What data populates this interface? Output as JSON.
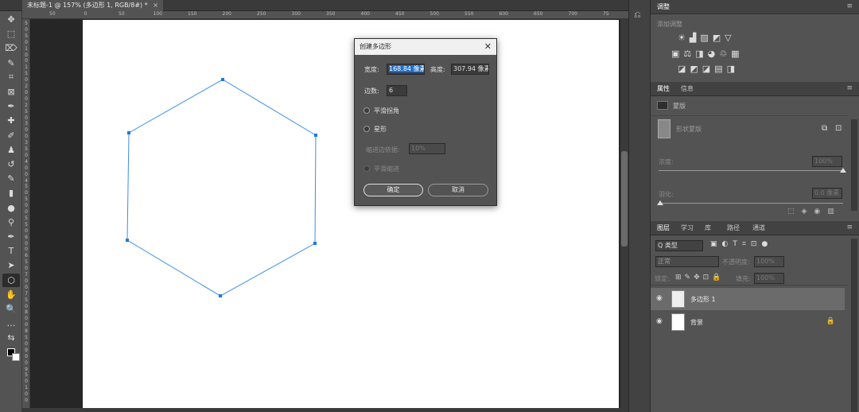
{
  "document_tab": {
    "title": "未标题-1 @ 157% (多边形 1, RGB/8#) *",
    "close": "×"
  },
  "ruler": {
    "h_ticks": [
      "50",
      "0",
      "50",
      "100",
      "150",
      "200",
      "250",
      "300",
      "350",
      "400",
      "450",
      "500",
      "550",
      "600",
      "650",
      "700",
      "75"
    ],
    "v_ticks": [
      "5",
      "0",
      "5",
      "0",
      "1",
      "0",
      "0",
      "1",
      "5",
      "0",
      "2",
      "0",
      "0",
      "2",
      "5",
      "0",
      "3",
      "0",
      "0",
      "3",
      "5",
      "0",
      "4",
      "0",
      "0",
      "4",
      "5",
      "0",
      "5",
      "0",
      "0",
      "5",
      "5",
      "0",
      "6",
      "0",
      "0",
      "6",
      "5",
      "0",
      "7",
      "0",
      "0",
      "7",
      "5",
      "0",
      "8",
      "0",
      "0",
      "8",
      "5",
      "0",
      "9",
      "0",
      "0",
      "9",
      "5",
      "0",
      "1",
      "0",
      "0"
    ]
  },
  "tools": [
    "✥",
    "⬚",
    "⌦",
    "✎",
    "⌗",
    "⊠",
    "✒",
    "✚",
    "✐",
    "♟",
    "↺",
    "✎",
    "▮",
    "●",
    "⚲",
    "✒",
    "T",
    "➤",
    "⬡",
    "✋",
    "🔍",
    "…",
    "⇆",
    "■"
  ],
  "dialog": {
    "title": "创建多边形",
    "close": "✕",
    "width_label": "宽度:",
    "width_value": "168.84 像素",
    "height_label": "高度:",
    "height_value": "307.94 像素",
    "sides_label": "边数:",
    "sides_value": "6",
    "smooth_corners": "平滑拐角",
    "star": "星形",
    "indent_label": "缩进边依据:",
    "indent_value": "10%",
    "smooth_indent": "平滑缩进",
    "ok": "确定",
    "cancel": "取消"
  },
  "adjustments_panel": {
    "tab": "调整",
    "subtitle": "添加调整",
    "row1": "☀▟▨◩▽",
    "row2": "▣⚖◨◕♲▦",
    "row3": "◪◩◪▤◨"
  },
  "properties_panel": {
    "tabs": [
      "属性",
      "信息"
    ],
    "mask_label": "蒙版",
    "shape_mask": "形状蒙版",
    "density_label": "浓度:",
    "density_value": "100%",
    "feather_label": "羽化:",
    "feather_value": "0.0 像素",
    "density_fraction": 1.0,
    "feather_fraction": 0.0
  },
  "layers_panel": {
    "tabs": [
      "图层",
      "学习",
      "库",
      "路径",
      "通道"
    ],
    "filter_label": "Q 类型",
    "blend_mode": "正常",
    "opacity_label": "不透明度:",
    "opacity_value": "100%",
    "lock_label": "锁定:",
    "fill_label": "填充:",
    "fill_value": "100%",
    "layers": [
      {
        "name": "多边形 1",
        "selected": true
      },
      {
        "name": "背景",
        "selected": false
      }
    ]
  },
  "colors": {
    "shape_stroke": "#3a8ee6",
    "handle": "#1e78e0",
    "selection": "#1e6fd0"
  }
}
